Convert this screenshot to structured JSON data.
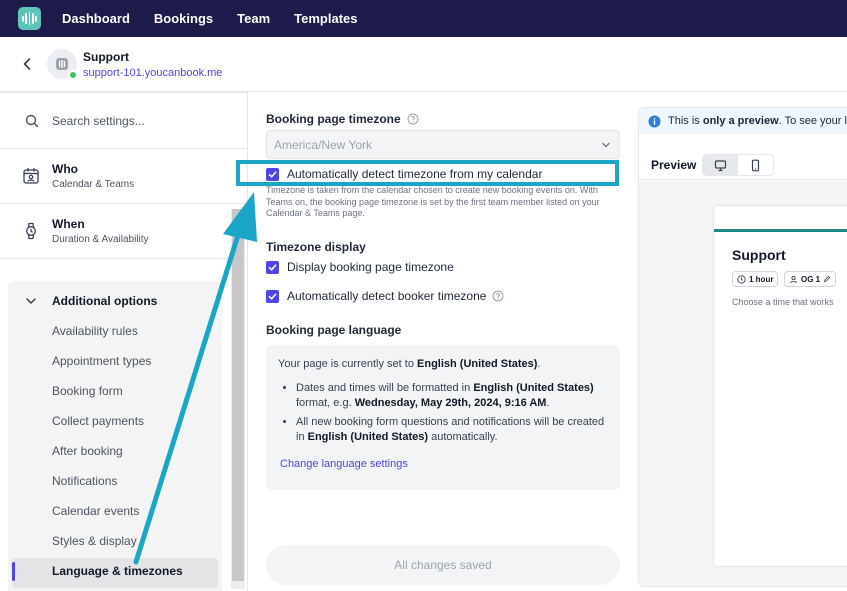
{
  "nav": {
    "logo_icon": "brand-logo-icon",
    "links": [
      "Dashboard",
      "Bookings",
      "Team",
      "Templates"
    ]
  },
  "header": {
    "title": "Support",
    "url": "support-101.youcanbook.me"
  },
  "sidebar": {
    "search_placeholder": "Search settings...",
    "who": {
      "title": "Who",
      "subtitle": "Calendar & Teams"
    },
    "when": {
      "title": "When",
      "subtitle": "Duration & Availability"
    },
    "additional_title": "Additional options",
    "sub_items": [
      "Availability rules",
      "Appointment types",
      "Booking form",
      "Collect payments",
      "After booking",
      "Notifications",
      "Calendar events",
      "Styles & display",
      "Language & timezones"
    ],
    "active_index": 8
  },
  "main": {
    "tz_label": "Booking page timezone",
    "tz_value": "America/New York",
    "auto_tz_label": "Automatically detect timezone from my calendar",
    "tz_hint": "Timezone is taken from the calendar chosen to create new booking events on. With Teams on, the booking page timezone is set by the first team member listed on your Calendar & Teams page.",
    "tz_display_label": "Timezone display",
    "display_tz_label": "Display booking page timezone",
    "detect_booker_label": "Automatically detect booker timezone",
    "lang_label": "Booking page language",
    "lang_intro_a": "Your page is currently set to ",
    "lang_value": "English (United States)",
    "lang_intro_b": ".",
    "bullet1_a": "Dates and times will be formatted in ",
    "bullet1_b": "English (United States)",
    "bullet1_c": " format, e.g. ",
    "bullet1_d": "Wednesday, May 29th, 2024, 9:16 AM",
    "bullet1_e": ".",
    "bullet2_a": "All new booking form questions and notifications will be created in ",
    "bullet2_b": "English (United States)",
    "bullet2_c": " automatically.",
    "change_link": "Change language settings",
    "saved_label": "All changes saved"
  },
  "preview": {
    "info_a": "This is ",
    "info_b": "only a preview",
    "info_c": ". To see your live",
    "label": "Preview",
    "card_title": "Support",
    "pill_duration": "1 hour",
    "pill_host": "OG 1",
    "card_sub": "Choose a time that works"
  },
  "colors": {
    "nav_bg": "#1c1b4a",
    "accent": "#4f46e5",
    "annotation": "#1aa6c7",
    "brand": "#5ec4b7"
  }
}
